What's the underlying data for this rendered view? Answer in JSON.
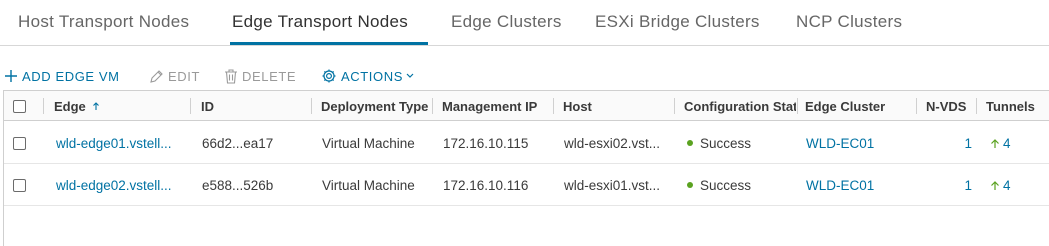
{
  "tabs": [
    {
      "label": "Host Transport Nodes",
      "active": false
    },
    {
      "label": "Edge Transport Nodes",
      "active": true
    },
    {
      "label": "Edge Clusters",
      "active": false
    },
    {
      "label": "ESXi Bridge Clusters",
      "active": false
    },
    {
      "label": "NCP Clusters",
      "active": false
    }
  ],
  "toolbar": {
    "add_label": "ADD EDGE VM",
    "edit_label": "EDIT",
    "delete_label": "DELETE",
    "actions_label": "ACTIONS"
  },
  "table": {
    "columns": [
      "Edge",
      "ID",
      "Deployment Type",
      "Management IP",
      "Host",
      "Configuration State",
      "Edge Cluster",
      "N-VDS",
      "Tunnels"
    ],
    "rows": [
      {
        "edge": "wld-edge01.vstell...",
        "id": "66d2...ea17",
        "deployment_type": "Virtual Machine",
        "management_ip": "172.16.10.115",
        "host": "wld-esxi02.vst...",
        "config_state": "Success",
        "edge_cluster": "WLD-EC01",
        "nvds": "1",
        "tunnels": "4"
      },
      {
        "edge": "wld-edge02.vstell...",
        "id": "e588...526b",
        "deployment_type": "Virtual Machine",
        "management_ip": "172.16.10.116",
        "host": "wld-esxi01.vst...",
        "config_state": "Success",
        "edge_cluster": "WLD-EC01",
        "nvds": "1",
        "tunnels": "4"
      }
    ]
  },
  "colors": {
    "accent": "#0072a3",
    "success": "#5aa220",
    "tunnel_up": "#5aa220"
  },
  "icons": {
    "add": "plus-icon",
    "edit": "pencil-icon",
    "delete": "trash-icon",
    "actions": "gear-icon",
    "sort": "sort-ascending-icon",
    "tunnel": "arrow-up-icon"
  }
}
